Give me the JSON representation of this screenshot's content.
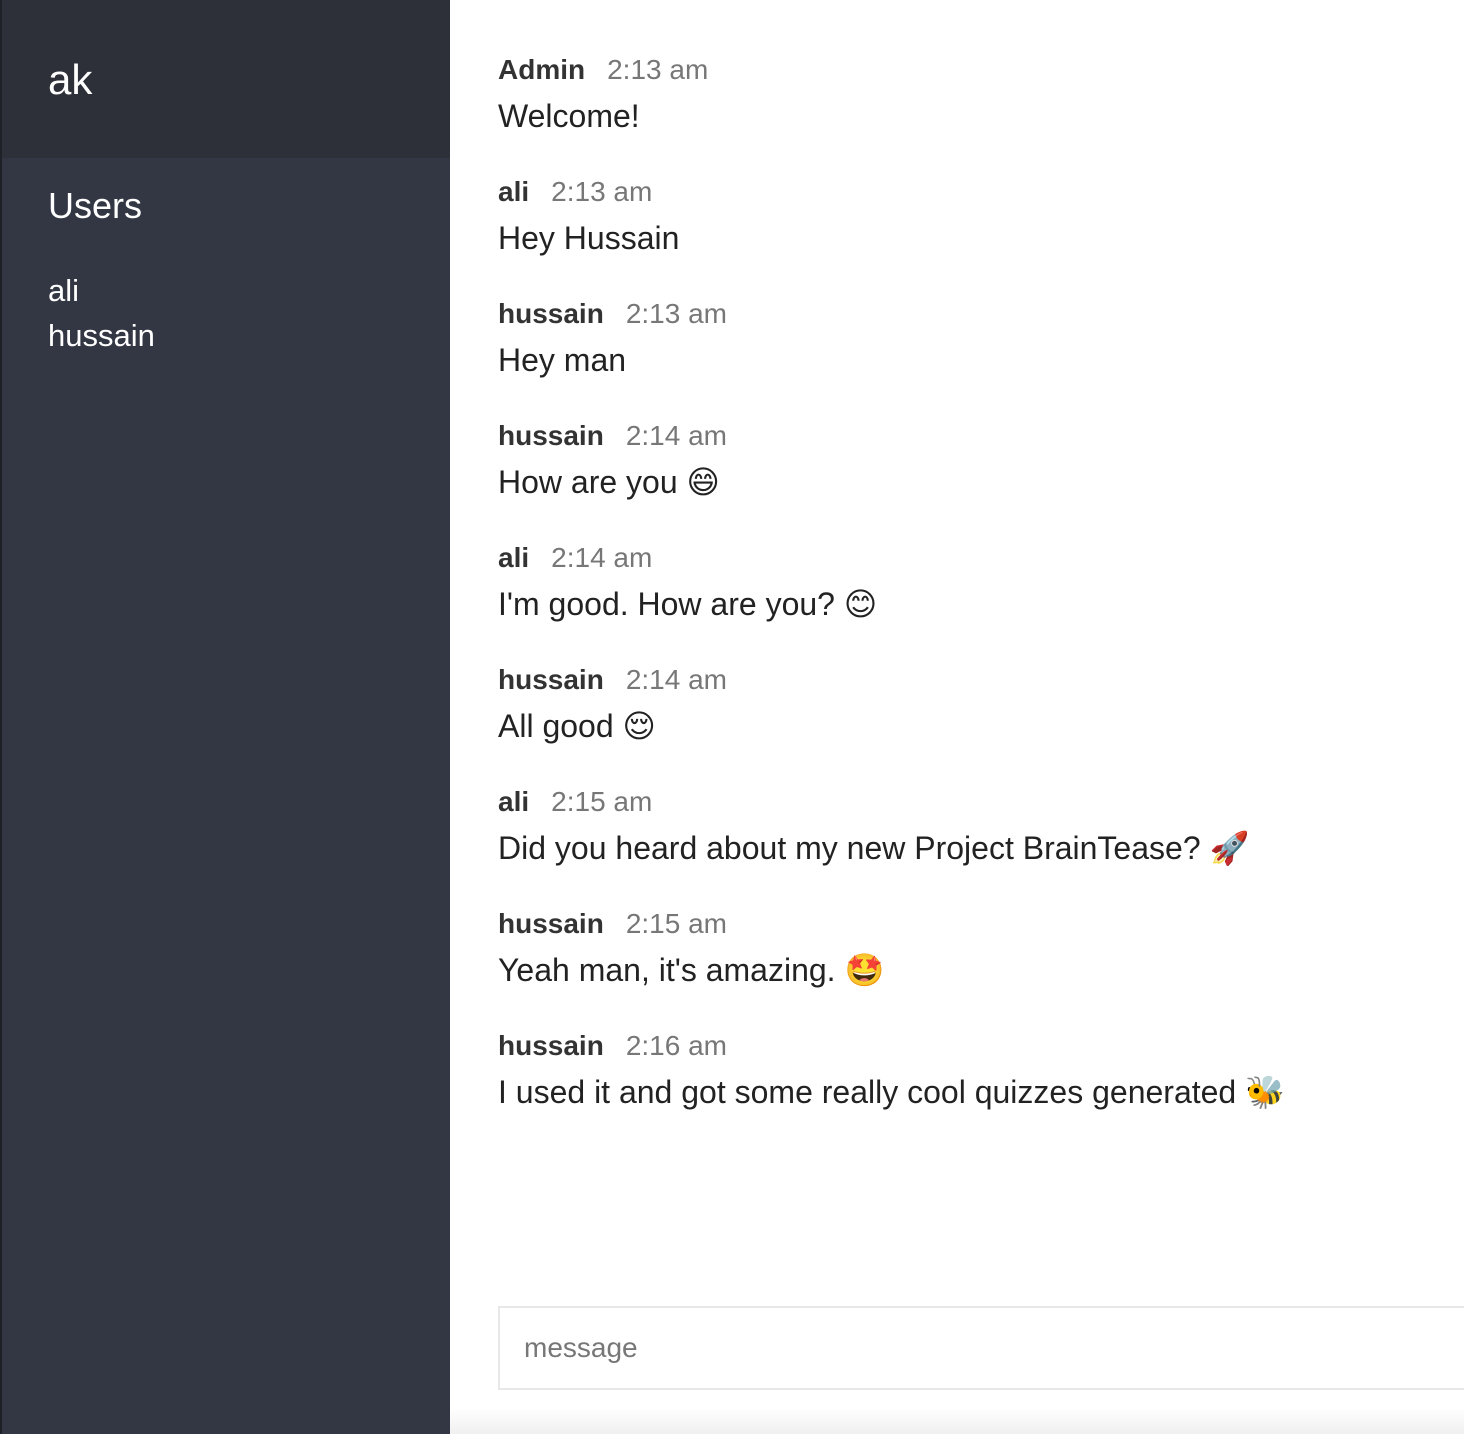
{
  "sidebar": {
    "room_name": "ak",
    "users_heading": "Users",
    "users": [
      "ali",
      "hussain"
    ]
  },
  "messages": [
    {
      "author": "Admin",
      "time": "2:13 am",
      "text": "Welcome!"
    },
    {
      "author": "ali",
      "time": "2:13 am",
      "text": "Hey Hussain"
    },
    {
      "author": "hussain",
      "time": "2:13 am",
      "text": "Hey man"
    },
    {
      "author": "hussain",
      "time": "2:14 am",
      "text": "How are you 😄"
    },
    {
      "author": "ali",
      "time": "2:14 am",
      "text": "I'm good. How are you? 😊"
    },
    {
      "author": "hussain",
      "time": "2:14 am",
      "text": "All good 😌"
    },
    {
      "author": "ali",
      "time": "2:15 am",
      "text": "Did you heard about my new Project BrainTease? 🚀"
    },
    {
      "author": "hussain",
      "time": "2:15 am",
      "text": "Yeah man, it's amazing. 🤩"
    },
    {
      "author": "hussain",
      "time": "2:16 am",
      "text": "I used it and got some really cool quizzes generated 🐝"
    }
  ],
  "composer": {
    "placeholder": "message",
    "value": ""
  },
  "colors": {
    "sidebar_bg": "#333744",
    "sidebar_header_bg": "#2e3039",
    "author_text": "#333333",
    "time_text": "#777777"
  }
}
